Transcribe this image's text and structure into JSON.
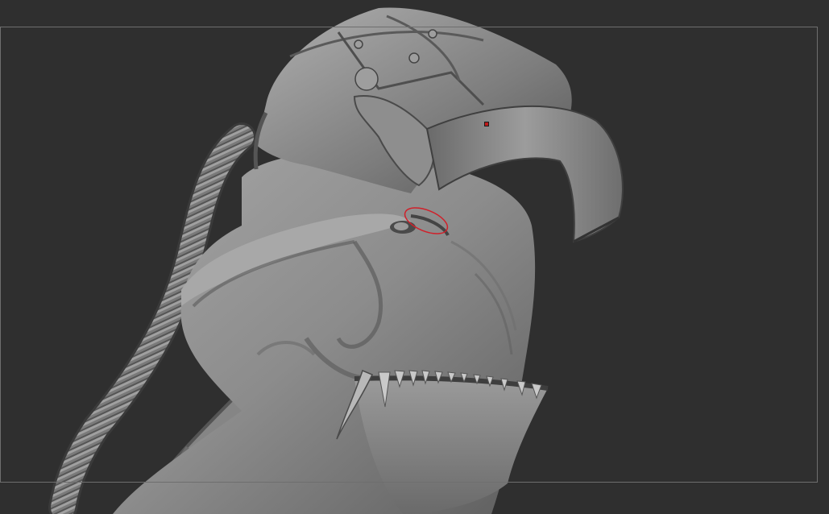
{
  "app": {
    "canvas_background": "#2f2f2f",
    "frame_color": "#6e6e6e"
  },
  "model": {
    "material_base": "#8a8a8a",
    "material_shadow": "#4a4a4a",
    "material_highlight": "#bdbdbd"
  },
  "brush_cursor": {
    "color": "#d0202a",
    "icon": "brush-ellipse-icon"
  },
  "pivot": {
    "color": "#c01818",
    "icon": "pivot-point-icon"
  }
}
